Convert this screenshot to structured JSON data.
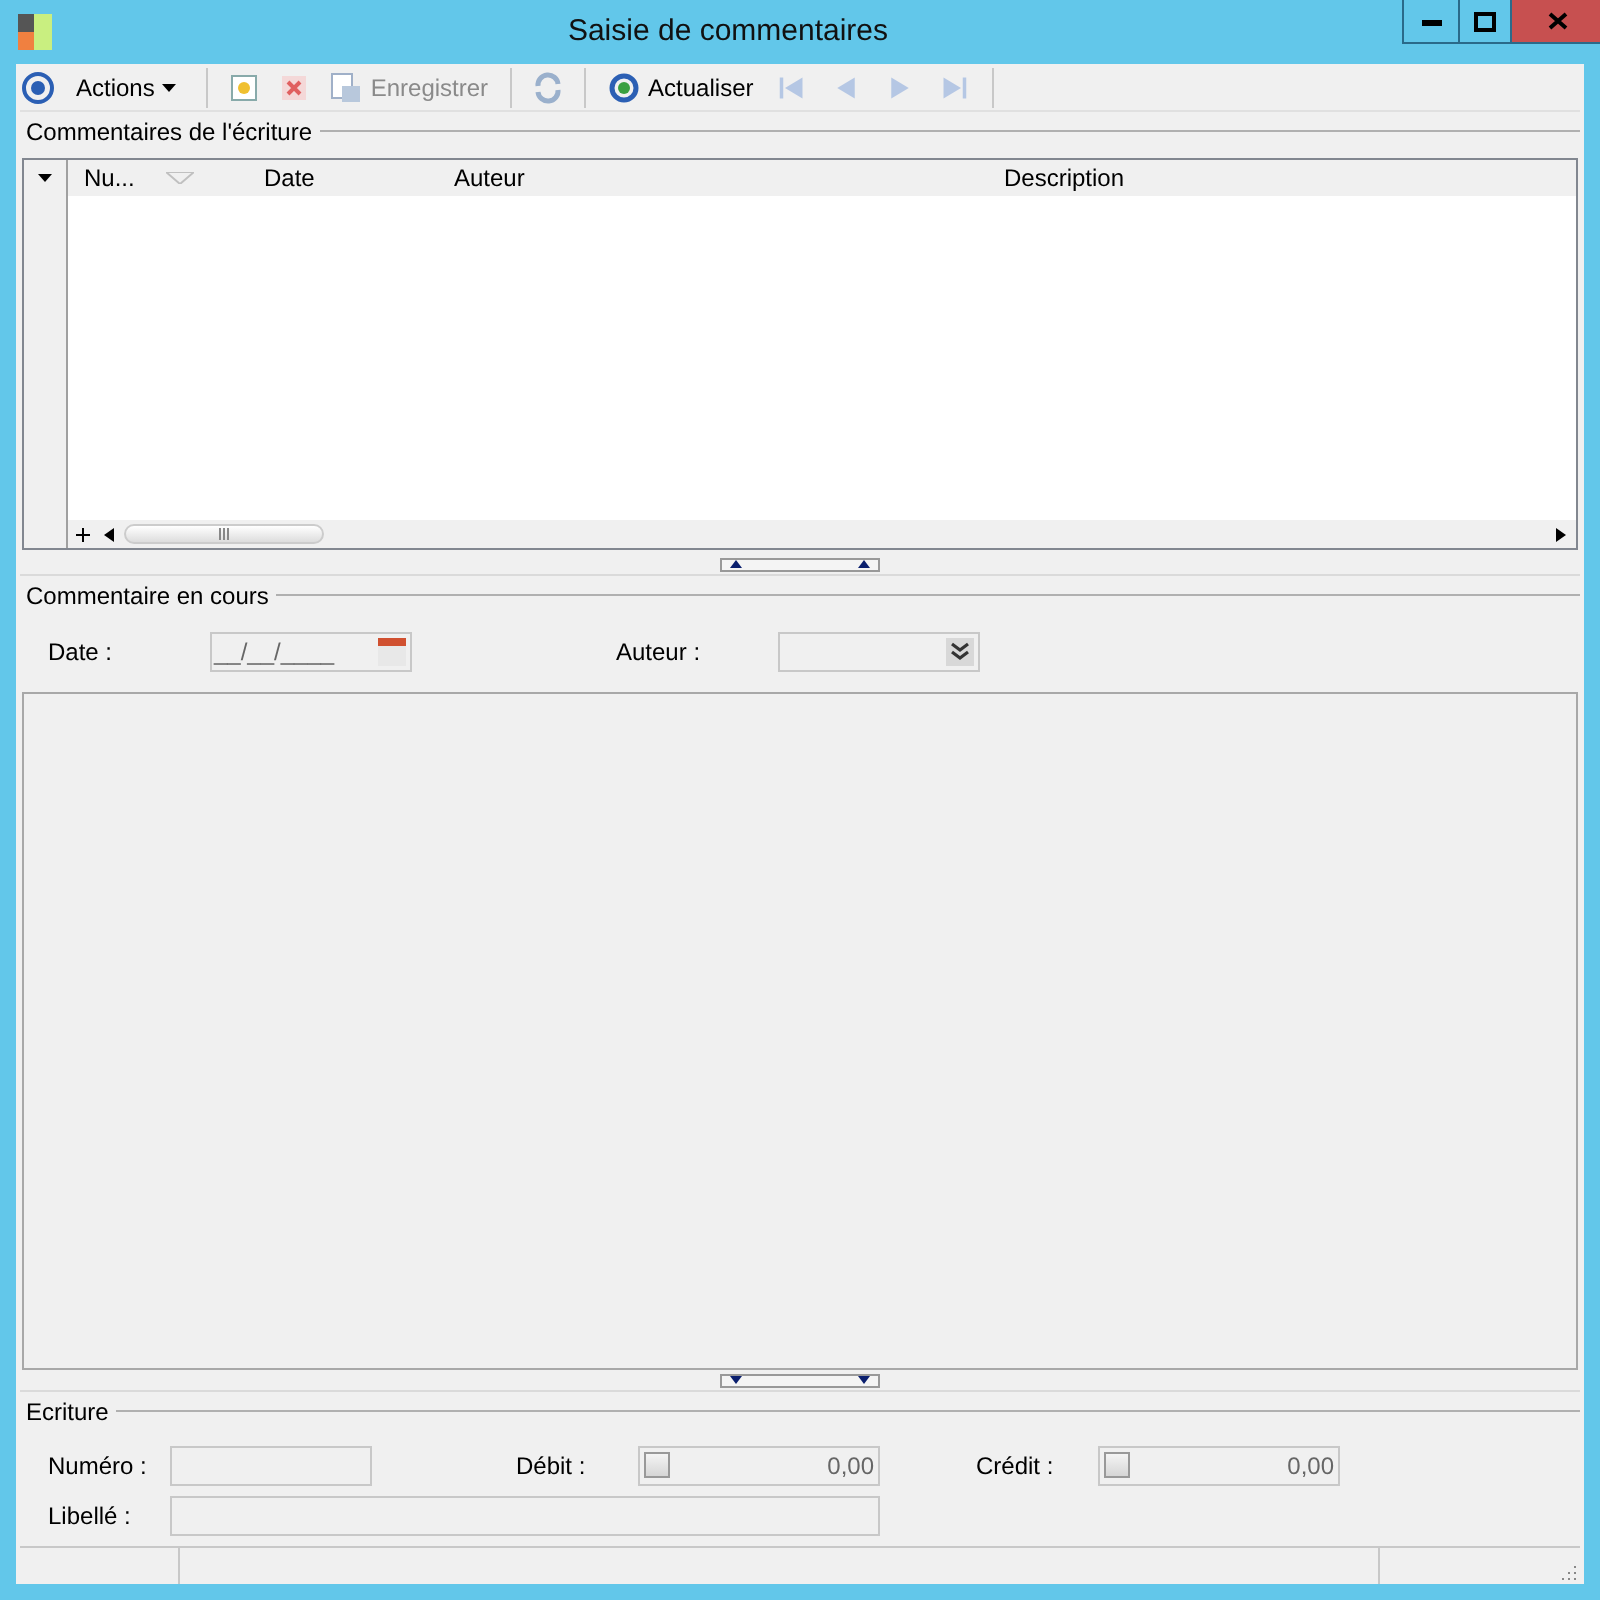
{
  "window": {
    "title": "Saisie de commentaires"
  },
  "toolbar": {
    "actions_label": "Actions",
    "save_label": "Enregistrer",
    "save_disabled": true,
    "refresh_label": "Actualiser",
    "nav_buttons": [
      {
        "kind": "first",
        "disabled": true
      },
      {
        "kind": "prev",
        "disabled": true
      },
      {
        "kind": "next",
        "disabled": true
      },
      {
        "kind": "last",
        "disabled": true
      }
    ]
  },
  "comments_group": {
    "title": "Commentaires de l'écriture",
    "columns": [
      {
        "label": "Nu...",
        "sorted": true
      },
      {
        "label": "Date",
        "sorted": false
      },
      {
        "label": "Auteur",
        "sorted": false
      },
      {
        "label": "Description",
        "sorted": false
      }
    ]
  },
  "current_group": {
    "title": "Commentaire en cours",
    "date_label": "Date :",
    "date_value": "__/__/____",
    "author_label": "Auteur :"
  },
  "entry_group": {
    "title": "Ecriture",
    "number_label": "Numéro :",
    "debit_label": "Débit :",
    "debit_value": "0,00",
    "debit_checked": false,
    "credit_label": "Crédit :",
    "credit_value": "0,00",
    "credit_checked": false,
    "label_label": "Libellé :"
  }
}
